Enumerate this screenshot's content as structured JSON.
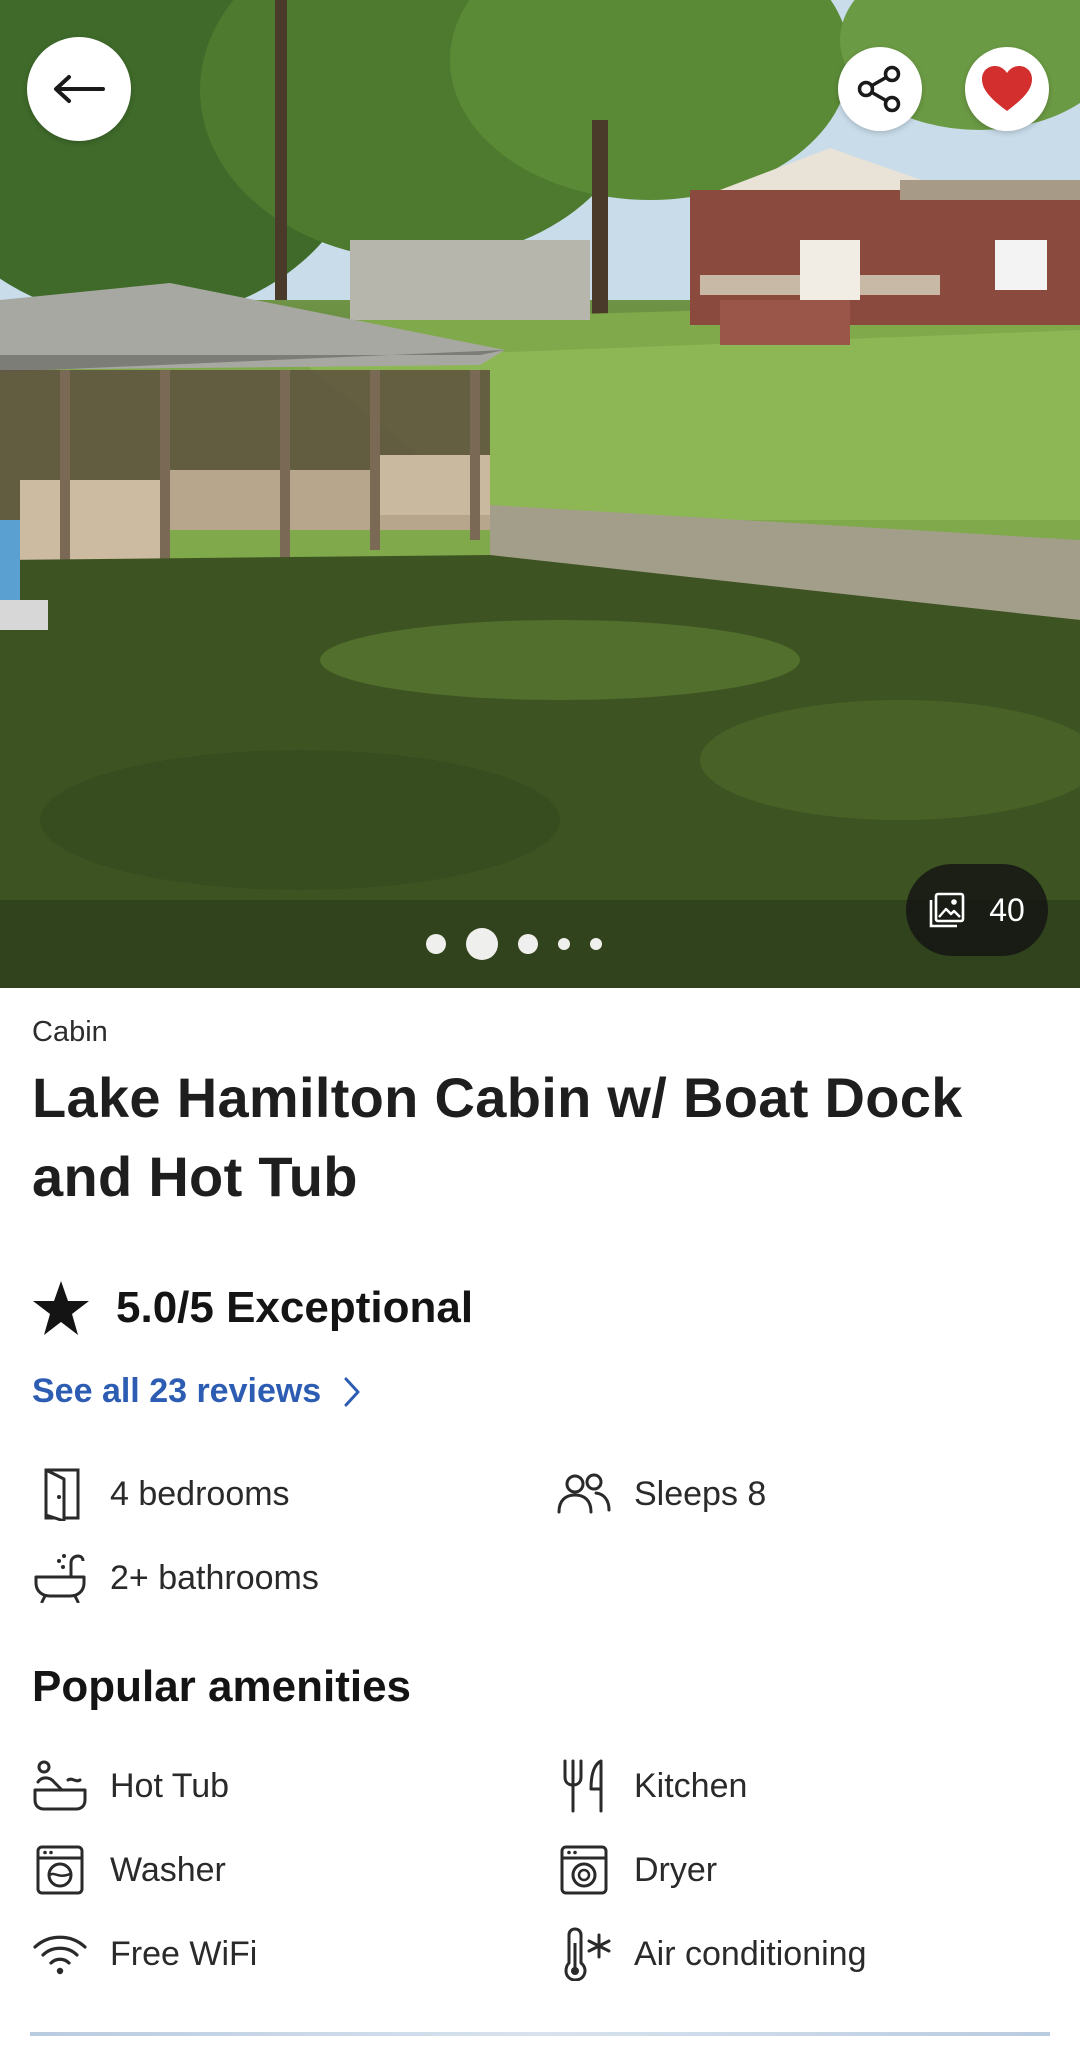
{
  "hero": {
    "photo_count": "40",
    "carousel_active_index": 1,
    "carousel_dot_count": 5
  },
  "listing": {
    "category": "Cabin",
    "title": "Lake Hamilton Cabin w/ Boat Dock and Hot Tub",
    "rating": "5.0/5 Exceptional",
    "reviews_link": "See all 23 reviews"
  },
  "features": [
    {
      "icon": "door-icon",
      "label": "4 bedrooms"
    },
    {
      "icon": "people-icon",
      "label": "Sleeps 8"
    },
    {
      "icon": "bathtub-icon",
      "label": "2+ bathrooms"
    }
  ],
  "amenities": {
    "heading": "Popular amenities",
    "items": [
      {
        "icon": "hot-tub-icon",
        "label": "Hot Tub"
      },
      {
        "icon": "kitchen-icon",
        "label": "Kitchen"
      },
      {
        "icon": "washer-icon",
        "label": "Washer"
      },
      {
        "icon": "dryer-icon",
        "label": "Dryer"
      },
      {
        "icon": "wifi-icon",
        "label": "Free WiFi"
      },
      {
        "icon": "thermometer-snowflake-icon",
        "label": "Air conditioning"
      }
    ]
  },
  "colors": {
    "link": "#2d5db3",
    "favorite": "#d32f2f",
    "text": "#1b1b1b"
  }
}
